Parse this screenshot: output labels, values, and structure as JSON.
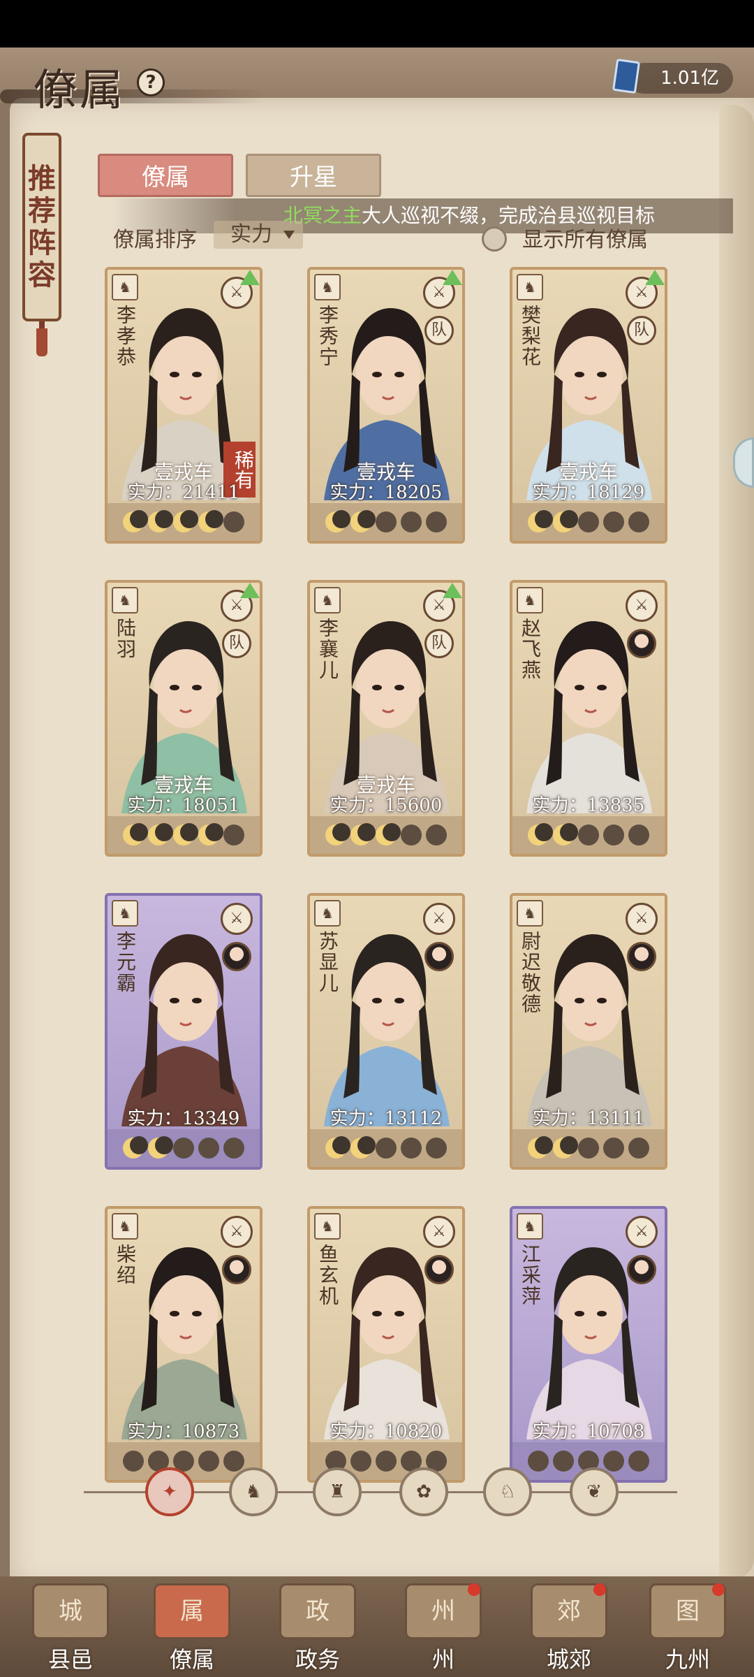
{
  "header": {
    "title": "僚属",
    "help_icon": "?",
    "currency_value": "1.01亿"
  },
  "side_scroll": {
    "chars": [
      "推",
      "荐",
      "阵",
      "容"
    ]
  },
  "tabs": [
    {
      "label": "僚属",
      "active": true
    },
    {
      "label": "升星",
      "active": false
    }
  ],
  "ticker": {
    "highlight": "北冥之主",
    "text": "大人巡视不缀，完成治县巡视目标"
  },
  "sort": {
    "label": "僚属排序",
    "value": "实力"
  },
  "show_all": {
    "label": "显示所有僚属"
  },
  "cards": [
    {
      "name": "李孝恭",
      "tier": "壹戎车",
      "power": "实力：21411",
      "moons_on": 4,
      "rare": "稀有",
      "team": "",
      "up": true,
      "purple": false
    },
    {
      "name": "李秀宁",
      "tier": "壹戎车",
      "power": "实力：18205",
      "moons_on": 2,
      "rare": "",
      "team": "队",
      "up": true,
      "purple": false
    },
    {
      "name": "樊梨花",
      "tier": "壹戎车",
      "power": "实力：18129",
      "moons_on": 2,
      "rare": "",
      "team": "队",
      "up": true,
      "purple": false
    },
    {
      "name": "陆羽",
      "tier": "壹戎车",
      "power": "实力：18051",
      "moons_on": 4,
      "rare": "",
      "team": "队",
      "up": true,
      "purple": false
    },
    {
      "name": "李襄儿",
      "tier": "壹戎车",
      "power": "实力：15600",
      "moons_on": 3,
      "rare": "",
      "team": "队",
      "up": true,
      "purple": false
    },
    {
      "name": "赵飞燕",
      "tier": "",
      "power": "实力：13835",
      "moons_on": 2,
      "rare": "",
      "team": "",
      "up": false,
      "purple": false
    },
    {
      "name": "李元霸",
      "tier": "",
      "power": "实力：13349",
      "moons_on": 2,
      "rare": "",
      "team": "",
      "up": false,
      "purple": true
    },
    {
      "name": "苏显儿",
      "tier": "",
      "power": "实力：13112",
      "moons_on": 2,
      "rare": "",
      "team": "",
      "up": false,
      "purple": false
    },
    {
      "name": "尉迟敬德",
      "tier": "",
      "power": "实力：13111",
      "moons_on": 2,
      "rare": "",
      "team": "",
      "up": false,
      "purple": false
    },
    {
      "name": "柴绍",
      "tier": "",
      "power": "实力：10873",
      "moons_on": 0,
      "rare": "",
      "team": "",
      "up": false,
      "purple": false
    },
    {
      "name": "鱼玄机",
      "tier": "",
      "power": "实力：10820",
      "moons_on": 0,
      "rare": "",
      "team": "",
      "up": false,
      "purple": false
    },
    {
      "name": "江采萍",
      "tier": "",
      "power": "实力：10708",
      "moons_on": 0,
      "rare": "",
      "team": "",
      "up": false,
      "purple": true
    }
  ],
  "filters": [
    "all",
    "cavalry",
    "gourd",
    "fan",
    "lion",
    "leaf"
  ],
  "nav": [
    {
      "label": "县邑",
      "icon": "城",
      "active": false,
      "dot": false
    },
    {
      "label": "僚属",
      "icon": "属",
      "active": true,
      "dot": false
    },
    {
      "label": "政务",
      "icon": "政",
      "active": false,
      "dot": false
    },
    {
      "label": "州",
      "icon": "州",
      "active": false,
      "dot": true
    },
    {
      "label": "城郊",
      "icon": "郊",
      "active": false,
      "dot": true
    },
    {
      "label": "九州",
      "icon": "图",
      "active": false,
      "dot": true
    }
  ],
  "colors": {
    "accent": "#b3412e",
    "paper": "#e9dfcb",
    "card_border": "#c29a6a",
    "purple_border": "#8472b0"
  }
}
